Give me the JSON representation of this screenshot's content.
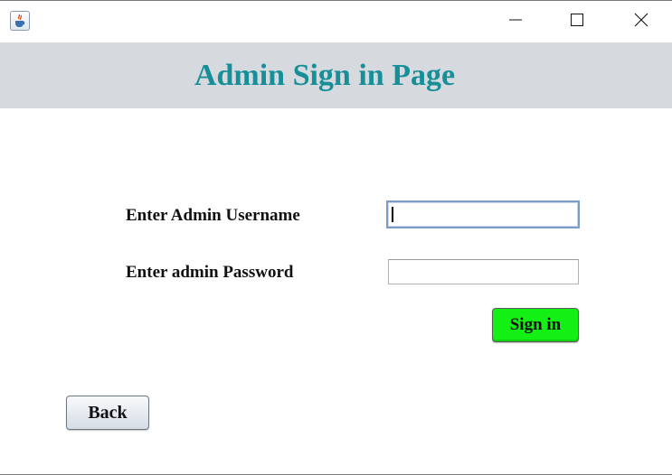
{
  "window": {
    "icon": "java-coffee-cup-icon",
    "controls": [
      "minimize-icon",
      "maximize-icon",
      "close-icon"
    ]
  },
  "header": {
    "title": "Admin Sign in Page",
    "background": "#d6d9de",
    "title_color": "#168f98"
  },
  "form": {
    "username_label": "Enter Admin Username",
    "username_value": "",
    "password_label": "Enter admin Password",
    "password_value": ""
  },
  "buttons": {
    "signin_label": "Sign in",
    "signin_color": "#13f013",
    "back_label": "Back"
  }
}
